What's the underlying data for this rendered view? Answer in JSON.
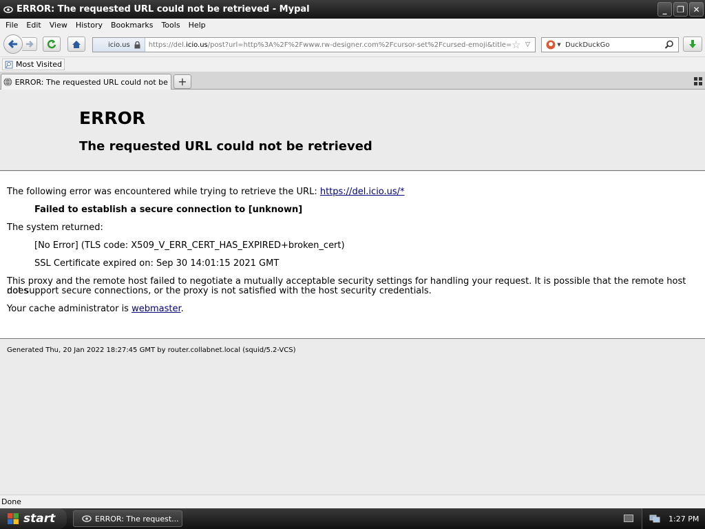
{
  "window": {
    "title": "ERROR: The requested URL could not be retrieved - Mypal",
    "minimize": "_",
    "restore": "❐",
    "close": "✕"
  },
  "menu": [
    "File",
    "Edit",
    "View",
    "History",
    "Bookmarks",
    "Tools",
    "Help"
  ],
  "nav": {
    "identity_label": "icio.us",
    "url_prefix": "https://del.",
    "url_domain": "icio.us",
    "url_rest": "/post?url=http%3A%2F%2Fwww.rw-designer.com%2Fcursor-set%2Fcursed-emoji&title=",
    "search_placeholder": "DuckDuckGo"
  },
  "bookmarks": {
    "most_visited": "Most Visited"
  },
  "tab": {
    "title": "ERROR: The requested URL could not be ret..."
  },
  "page": {
    "heading": "ERROR",
    "subheading": "The requested URL could not be retrieved",
    "intro": "The following error was encountered while trying to retrieve the URL:",
    "intro_link": "https://del.icio.us/*",
    "failure": "Failed to establish a secure connection to [unknown]",
    "system_returned": "The system returned:",
    "tls_error": "[No Error] (TLS code: X509_V_ERR_CERT_HAS_EXPIRED+broken_cert)",
    "cert_expiry": "SSL Certificate expired on: Sep 30 14:01:15 2021 GMT",
    "explanation_line1": "This proxy and the remote host failed to negotiate a mutually acceptable security settings for handling your request. It is possible that the remote host does",
    "explanation_line2": "not support secure connections, or the proxy is not satisfied with the host security credentials.",
    "admin_prefix": "Your cache administrator is",
    "admin_link": "webmaster",
    "admin_suffix": ".",
    "generated": "Generated Thu, 20 Jan 2022 18:27:45 GMT by router.collabnet.local (squid/5.2-VCS)"
  },
  "status": {
    "text": "Done"
  },
  "taskbar": {
    "start": "start",
    "task_label": "ERROR: The request...",
    "clock": "1:27 PM"
  }
}
